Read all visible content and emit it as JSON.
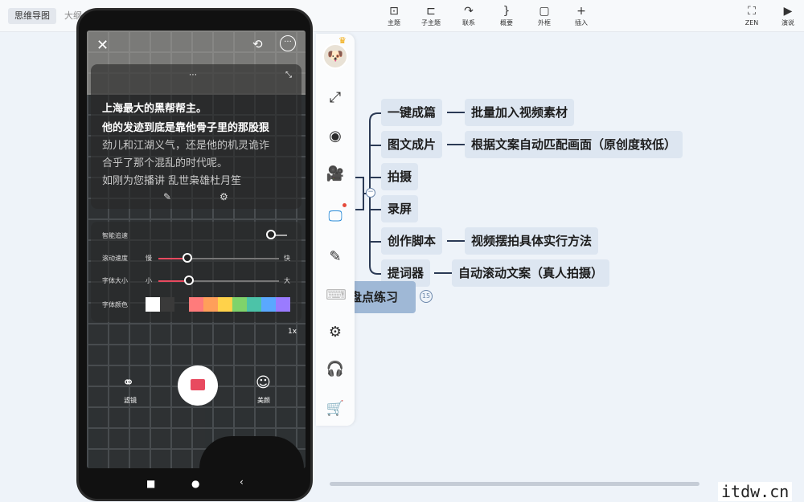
{
  "tabs": {
    "mindmap": "思维导图",
    "outline": "大纲"
  },
  "toolbar": [
    {
      "icon": "⊡",
      "label": "主题"
    },
    {
      "icon": "⊏",
      "label": "子主题"
    },
    {
      "icon": "↷",
      "label": "联系"
    },
    {
      "icon": "}",
      "label": "概要"
    },
    {
      "icon": "▢",
      "label": "外框"
    },
    {
      "icon": "+",
      "label": "插入"
    },
    {
      "icon": "⛶",
      "label": "ZEN"
    },
    {
      "icon": "▶",
      "label": "演说"
    }
  ],
  "mindmap": {
    "center": "盘点练习",
    "badge": "15",
    "branches": [
      {
        "label": "一键成篇",
        "detail": "批量加入视频素材"
      },
      {
        "label": "图文成片",
        "detail": "根据文案自动匹配画面（原创度较低）"
      },
      {
        "label": "拍摄",
        "detail": ""
      },
      {
        "label": "录屏",
        "detail": ""
      },
      {
        "label": "创作脚本",
        "detail": "视频摆拍具体实行方法"
      },
      {
        "label": "提词器",
        "detail": "自动滚动文案（真人拍摄）"
      }
    ]
  },
  "phone": {
    "prompt_lines": [
      "上海最大的黑帮帮主。",
      "他的发迹到底是靠他骨子里的那股狠",
      "劲儿和江湖义气，还是他的机灵诡诈",
      "合乎了那个混乱的时代呢。",
      "如刚为您播讲  乱世枭雄杜月笙"
    ],
    "controls": {
      "smart_follow": "智能追速",
      "scroll_speed": "滚动速度",
      "font_size": "字体大小",
      "font_color": "字体颜色",
      "slow": "慢",
      "fast": "快",
      "small": "小",
      "big": "大"
    },
    "zoom": "1x",
    "filter_label": "滤镜",
    "beauty_label": "美颜"
  },
  "colors": {
    "swatches": [
      "#ffffff",
      "#3a3a3a",
      "#ff7b7b",
      "#ff9f5a",
      "#ffd24a",
      "#7fd36b",
      "#4cc3a8",
      "#5aa8ff",
      "#9a7bff"
    ]
  },
  "watermark": "itdw.cn"
}
